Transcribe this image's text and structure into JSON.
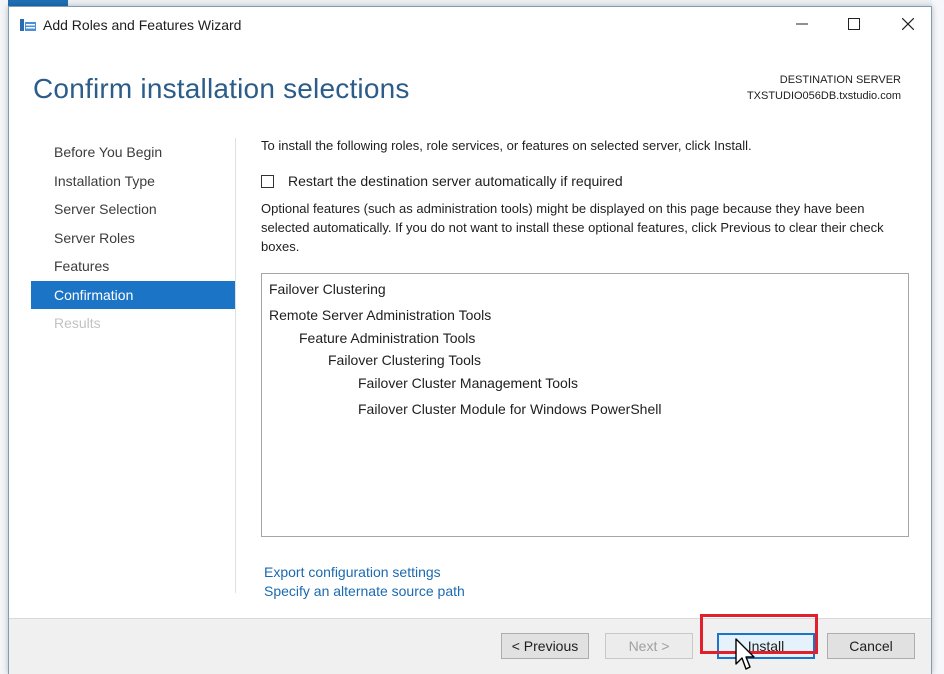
{
  "window": {
    "title": "Add Roles and Features Wizard",
    "controls": {
      "minimize": "—",
      "maximize": "☐",
      "close": "✕"
    }
  },
  "header": {
    "page_title": "Confirm installation selections",
    "destination_label": "DESTINATION SERVER",
    "destination_server": "TXSTUDIO056DB.txstudio.com"
  },
  "nav": {
    "items": [
      {
        "label": "Before You Begin",
        "state": "normal"
      },
      {
        "label": "Installation Type",
        "state": "normal"
      },
      {
        "label": "Server Selection",
        "state": "normal"
      },
      {
        "label": "Server Roles",
        "state": "normal"
      },
      {
        "label": "Features",
        "state": "normal"
      },
      {
        "label": "Confirmation",
        "state": "active"
      },
      {
        "label": "Results",
        "state": "disabled"
      }
    ]
  },
  "content": {
    "intro": "To install the following roles, role services, or features on selected server, click Install.",
    "restart_checkbox_label": "Restart the destination server automatically if required",
    "restart_checked": false,
    "optional_note": "Optional features (such as administration tools) might be displayed on this page because they have been selected automatically. If you do not want to install these optional features, click Previous to clear their check boxes.",
    "features": [
      {
        "label": "Failover Clustering",
        "level": 0
      },
      {
        "label": "Remote Server Administration Tools",
        "level": 0
      },
      {
        "label": "Feature Administration Tools",
        "level": 1
      },
      {
        "label": "Failover Clustering Tools",
        "level": 2
      },
      {
        "label": "Failover Cluster Management Tools",
        "level": 3
      },
      {
        "label": "Failover Cluster Module for Windows PowerShell",
        "level": 3
      }
    ],
    "links": {
      "export": "Export configuration settings",
      "alternate_source": "Specify an alternate source path"
    }
  },
  "footer": {
    "previous": "< Previous",
    "next": "Next >",
    "install": "Install",
    "cancel": "Cancel"
  },
  "colors": {
    "accent": "#1b74c5",
    "title_blue": "#2b5c8a",
    "link_blue": "#1b6ab0",
    "highlight_red": "#e0202a"
  }
}
